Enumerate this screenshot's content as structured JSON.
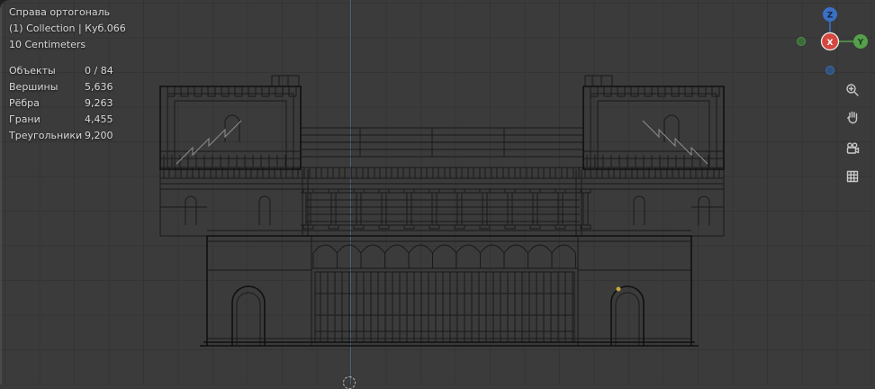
{
  "viewport_header": {
    "view_name": "Справа ортогональ",
    "collection": "(1) Collection | Куб.066",
    "scale": "10 Centimeters"
  },
  "stats": {
    "rows": [
      {
        "label": "Объекты",
        "value": "0 / 84"
      },
      {
        "label": "Вершины",
        "value": "5,636"
      },
      {
        "label": "Рёбра",
        "value": "9,263"
      },
      {
        "label": "Грани",
        "value": "4,455"
      },
      {
        "label": "Треугольники",
        "value": "9,200"
      }
    ]
  },
  "gizmo": {
    "x_label": "X",
    "y_label": "Y",
    "z_label": "Z"
  },
  "toolbar": {
    "icons": [
      "zoom-icon",
      "pan-hand-icon",
      "camera-view-icon",
      "grid-ortho-icon"
    ]
  },
  "colors": {
    "viewport_bg": "#3b3b3b",
    "grid_line": "#343434",
    "wireframe": "#1a1a1a",
    "wireframe_bold": "#101010",
    "wireframe_light": "#8d8d8d",
    "axis_x": "#d6473f",
    "axis_y": "#55a04a",
    "axis_z": "#3a6fc4",
    "z_axis_line": "#54688c",
    "origin_dot": "#c8a53e",
    "overlay_text": "#d9d9d9"
  }
}
